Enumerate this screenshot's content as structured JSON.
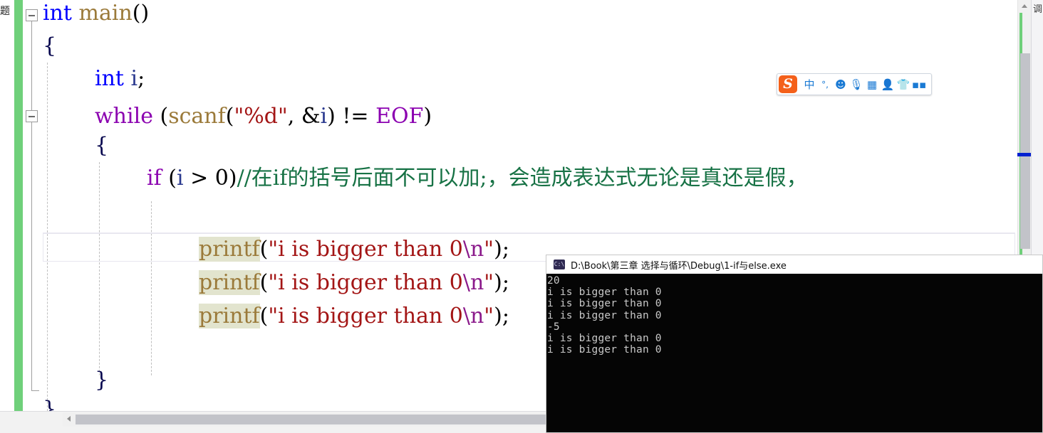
{
  "editor": {
    "lines": [
      {
        "indent": 0,
        "tokens": [
          {
            "t": "int",
            "c": "kw"
          },
          {
            "t": " ",
            "c": "punct"
          },
          {
            "t": "main",
            "c": "fn"
          },
          {
            "t": "()",
            "c": "punct"
          }
        ]
      },
      {
        "indent": 0,
        "tokens": [
          {
            "t": "{",
            "c": "brace"
          }
        ]
      },
      {
        "indent": 0,
        "tokens": [
          {
            "t": "int",
            "c": "kw"
          },
          {
            "t": " ",
            "c": "punct"
          },
          {
            "t": "i",
            "c": "ident"
          },
          {
            "t": ";",
            "c": "punct"
          }
        ]
      },
      {
        "indent": 0,
        "tokens": [
          {
            "t": "while",
            "c": "kwctl"
          },
          {
            "t": " (",
            "c": "punct"
          },
          {
            "t": "scanf",
            "c": "fn"
          },
          {
            "t": "(",
            "c": "punct"
          },
          {
            "t": "\"%d\"",
            "c": "str"
          },
          {
            "t": ", &",
            "c": "punct"
          },
          {
            "t": "i",
            "c": "ident"
          },
          {
            "t": ") != ",
            "c": "punct"
          },
          {
            "t": "EOF",
            "c": "kwctl"
          },
          {
            "t": ")",
            "c": "punct"
          }
        ]
      },
      {
        "indent": 0,
        "tokens": [
          {
            "t": "{",
            "c": "brace"
          }
        ]
      },
      {
        "indent": 0,
        "tokens": [
          {
            "t": "if",
            "c": "kwctl"
          },
          {
            "t": " (",
            "c": "punct"
          },
          {
            "t": "i",
            "c": "ident"
          },
          {
            "t": " > ",
            "c": "punct"
          },
          {
            "t": "0",
            "c": "punct"
          },
          {
            "t": ")",
            "c": "punct"
          },
          {
            "t": "//在if的括号后面不可以加;，会造成表达式无论是真还是假，",
            "c": "cmt"
          }
        ]
      },
      {
        "indent": 0,
        "tokens": []
      },
      {
        "indent": 0,
        "tokens": [
          {
            "t": "printf",
            "c": "fn",
            "hl": true
          },
          {
            "t": "(",
            "c": "punct"
          },
          {
            "t": "\"i is bigger than 0",
            "c": "str"
          },
          {
            "t": "\\n",
            "c": "esc"
          },
          {
            "t": "\"",
            "c": "str"
          },
          {
            "t": ");",
            "c": "punct"
          }
        ]
      },
      {
        "indent": 0,
        "tokens": [
          {
            "t": "printf",
            "c": "fn",
            "hl": true
          },
          {
            "t": "(",
            "c": "punct"
          },
          {
            "t": "\"i is bigger than 0",
            "c": "str"
          },
          {
            "t": "\\n",
            "c": "esc"
          },
          {
            "t": "\"",
            "c": "str"
          },
          {
            "t": ");",
            "c": "punct"
          }
        ]
      },
      {
        "indent": 0,
        "tokens": [
          {
            "t": "printf",
            "c": "fn",
            "hl": true
          },
          {
            "t": "(",
            "c": "punct"
          },
          {
            "t": "\"i is bigger than 0",
            "c": "str"
          },
          {
            "t": "\\n",
            "c": "esc"
          },
          {
            "t": "\"",
            "c": "str"
          },
          {
            "t": ");",
            "c": "punct"
          }
        ]
      },
      {
        "indent": 0,
        "tokens": []
      },
      {
        "indent": 0,
        "tokens": [
          {
            "t": "}",
            "c": "brace"
          }
        ]
      },
      {
        "indent": 0,
        "tokens": [
          {
            "t": "}",
            "c": "brace"
          }
        ]
      }
    ],
    "line_text": [
      "int main()",
      "{",
      "    int i;",
      "    while (scanf(\"%d\", &i) != EOF)",
      "    {",
      "        if (i > 0)//在if的括号后面不可以加;，会造成表达式无论是真还是假，",
      "",
      "            printf(\"i is bigger than 0\\n\");",
      "            printf(\"i is bigger than 0\\n\");",
      "            printf(\"i is bigger than 0\\n\");",
      "",
      "        }",
      "    }"
    ],
    "colors": {
      "keyword": "#0000ff",
      "control_keyword": "#8b00b0",
      "function": "#9b7a3a",
      "string": "#a31515",
      "comment": "#177245",
      "identifier": "#2b3a8f",
      "highlight_background": "#e2e4ce",
      "change_bar": "#6fd07a"
    },
    "scrollbar": {
      "up_arrow": "scroll-up-arrow",
      "marker_color": "#0020d0"
    },
    "rail_tab_label": "调"
  },
  "bottom": {
    "tab_label": "题",
    "hscroll_left_arrow": "scroll-left-arrow"
  },
  "ime": {
    "logo_text": "S",
    "items": [
      {
        "name": "language-mode-icon",
        "glyph": "中"
      },
      {
        "name": "punctuation-mode-icon",
        "glyph": "°,"
      },
      {
        "name": "emoji-icon",
        "glyph": "☻"
      },
      {
        "name": "voice-input-icon",
        "glyph": "🎙"
      },
      {
        "name": "soft-keyboard-icon",
        "glyph": "▦"
      },
      {
        "name": "user-account-icon",
        "glyph": "👤",
        "gray": true
      },
      {
        "name": "skin-icon",
        "glyph": "👕"
      },
      {
        "name": "toolbox-icon",
        "glyph": "▪▪"
      }
    ]
  },
  "console": {
    "icon_text": "C:\\",
    "title": "D:\\Book\\第三章 选择与循环\\Debug\\1-if与else.exe",
    "output": [
      "20",
      "i is bigger than 0",
      "i is bigger than 0",
      "i is bigger than 0",
      "-5",
      "i is bigger than 0",
      "i is bigger than 0"
    ]
  }
}
